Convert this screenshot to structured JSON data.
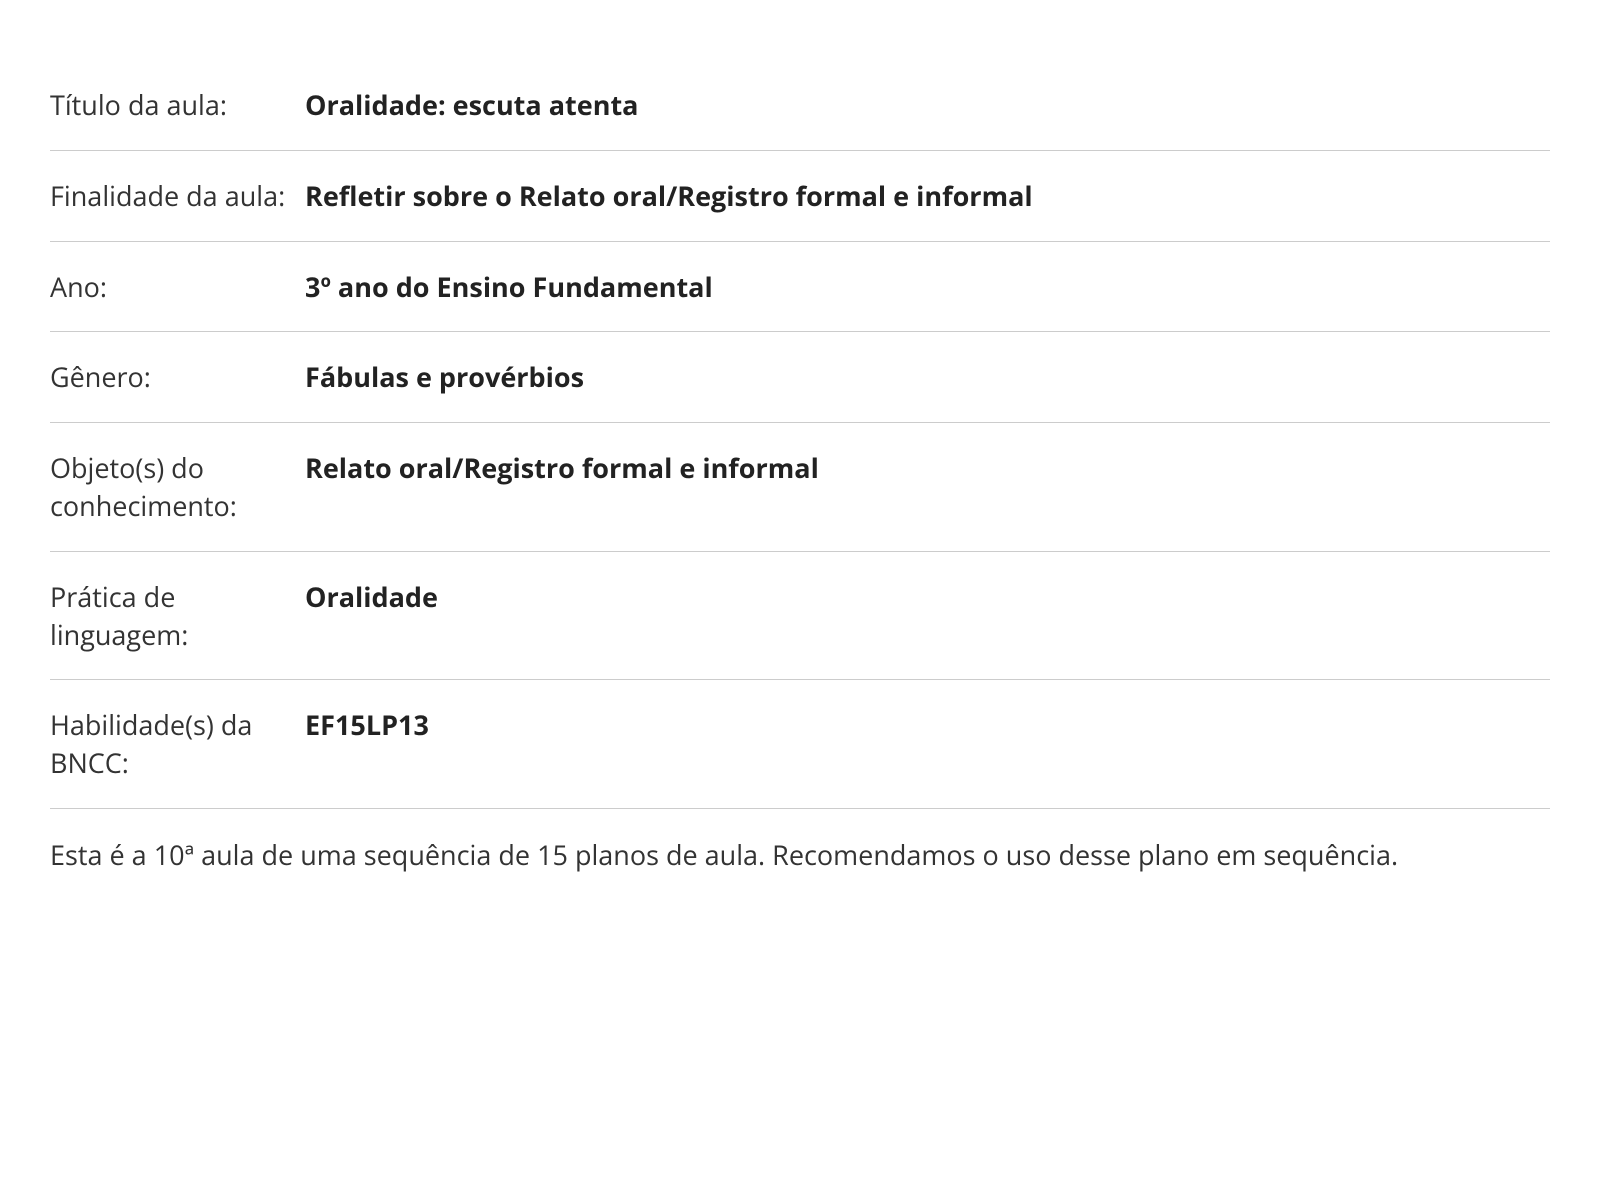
{
  "rows": [
    {
      "label": "Título da aula:",
      "value": "Oralidade: escuta atenta"
    },
    {
      "label": "Finalidade da aula:",
      "value": "Refletir sobre o Relato oral/Registro formal e informal"
    },
    {
      "label": "Ano:",
      "value": "3º ano do Ensino Fundamental"
    },
    {
      "label": "Gênero:",
      "value": "Fábulas e provérbios"
    },
    {
      "label": "Objeto(s) do conhecimento:",
      "value": "Relato oral/Registro formal e informal"
    },
    {
      "label": "Prática de linguagem:",
      "value": "Oralidade"
    },
    {
      "label": "Habilidade(s) da BNCC:",
      "value": "EF15LP13"
    }
  ],
  "footer_note": "Esta é a 10ª aula de uma sequência de 15 planos de aula. Recomendamos o uso desse plano em sequência."
}
